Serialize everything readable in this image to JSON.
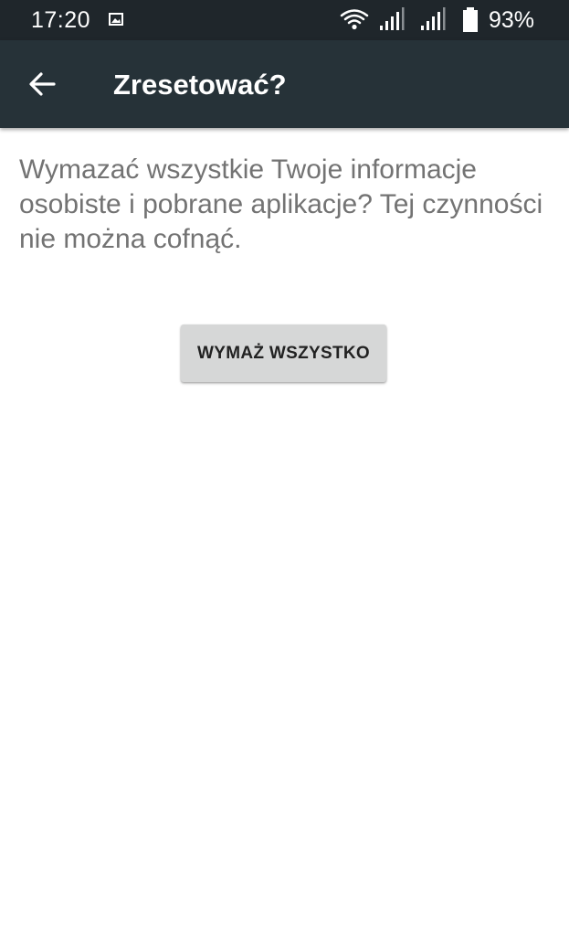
{
  "status_bar": {
    "time": "17:20",
    "battery_percent": "93%",
    "battery_level": 0.93,
    "icons": [
      "gallery-icon",
      "wifi-icon",
      "signal-icon",
      "signal-icon",
      "battery-icon"
    ]
  },
  "app_bar": {
    "title": "Zresetować?",
    "back_icon": "arrow-back-icon"
  },
  "main": {
    "message": "Wymazać wszystkie Twoje informacje osobiste i pobrane aplikacje? Tej czynności nie można cofnąć.",
    "erase_button_label": "WYMAŻ WSZYSTKO"
  },
  "colors": {
    "status_bar": "#1f262b",
    "app_bar": "#263238",
    "message_text": "#737373",
    "button_bg": "#d6d7d7"
  }
}
